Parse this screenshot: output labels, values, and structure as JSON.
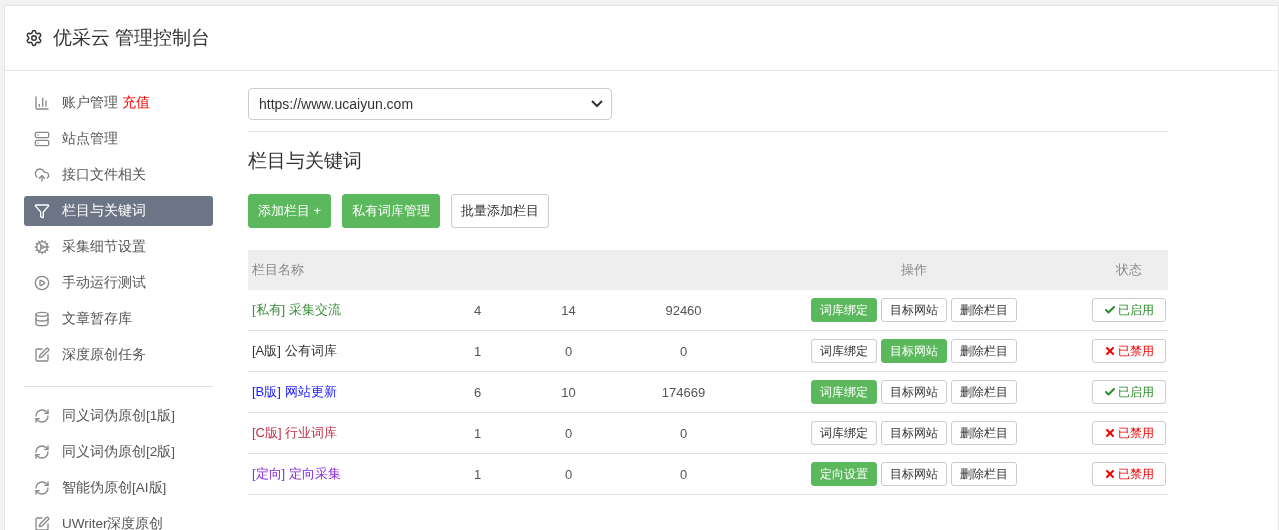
{
  "header": {
    "title": "优采云 管理控制台"
  },
  "sidebar": {
    "items": [
      {
        "kind": "link",
        "label": "账户管理",
        "extra": "充值",
        "selected": false
      },
      {
        "kind": "link",
        "label": "站点管理",
        "selected": false
      },
      {
        "kind": "link",
        "label": "接口文件相关",
        "selected": false
      },
      {
        "kind": "link",
        "label": "栏目与关键词",
        "selected": true
      },
      {
        "kind": "link",
        "label": "采集细节设置",
        "selected": false
      },
      {
        "kind": "link",
        "label": "手动运行测试",
        "selected": false
      },
      {
        "kind": "link",
        "label": "文章暂存库",
        "selected": false
      },
      {
        "kind": "link",
        "label": "深度原创任务",
        "selected": false
      },
      {
        "kind": "divider"
      },
      {
        "kind": "link",
        "label": "同义词伪原创[1版]",
        "selected": false
      },
      {
        "kind": "link",
        "label": "同义词伪原创[2版]",
        "selected": false
      },
      {
        "kind": "link",
        "label": "智能伪原创[AI版]",
        "selected": false
      },
      {
        "kind": "link",
        "label": "UWriter深度原创",
        "selected": false
      }
    ]
  },
  "site_select": {
    "value": "https://www.ucaiyun.com"
  },
  "section_title": "栏目与关键词",
  "toolbar": [
    {
      "label": "添加栏目 +",
      "primary": true
    },
    {
      "label": "私有词库管理",
      "primary": true
    },
    {
      "label": "批量添加栏目",
      "primary": false
    }
  ],
  "table": {
    "columns": [
      "栏目名称",
      "操作",
      "状态"
    ],
    "rows": [
      {
        "tag": "[私有]",
        "name": "采集交流",
        "color": "#3c8d3c",
        "column_2": "4",
        "column_3": "14",
        "column_4": "92460",
        "actions": [
          {
            "label": "词库绑定",
            "primary": true
          },
          {
            "label": "目标网站",
            "primary": false
          },
          {
            "label": "删除栏目",
            "primary": false
          }
        ],
        "enabled": true,
        "status": "已启用"
      },
      {
        "tag": "[A版]",
        "name": "公有词库",
        "color": "#333333",
        "column_2": "1",
        "column_3": "0",
        "column_4": "0",
        "actions": [
          {
            "label": "词库绑定",
            "primary": false
          },
          {
            "label": "目标网站",
            "primary": true
          },
          {
            "label": "删除栏目",
            "primary": false
          }
        ],
        "enabled": false,
        "status": "已禁用"
      },
      {
        "tag": "[B版]",
        "name": "网站更新",
        "color": "#1a1aff",
        "column_2": "6",
        "column_3": "10",
        "column_4": "174669",
        "actions": [
          {
            "label": "词库绑定",
            "primary": true
          },
          {
            "label": "目标网站",
            "primary": false
          },
          {
            "label": "删除栏目",
            "primary": false
          }
        ],
        "enabled": true,
        "status": "已启用"
      },
      {
        "tag": "[C版]",
        "name": "行业词库",
        "color": "#c0304a",
        "column_2": "1",
        "column_3": "0",
        "column_4": "0",
        "actions": [
          {
            "label": "词库绑定",
            "primary": false
          },
          {
            "label": "目标网站",
            "primary": false
          },
          {
            "label": "删除栏目",
            "primary": false
          }
        ],
        "enabled": false,
        "status": "已禁用"
      },
      {
        "tag": "[定向]",
        "name": "定向采集",
        "color": "#8a2be2",
        "column_2": "1",
        "column_3": "0",
        "column_4": "0",
        "actions": [
          {
            "label": "定向设置",
            "primary": true
          },
          {
            "label": "目标网站",
            "primary": false
          },
          {
            "label": "删除栏目",
            "primary": false
          }
        ],
        "enabled": false,
        "status": "已禁用"
      }
    ]
  }
}
